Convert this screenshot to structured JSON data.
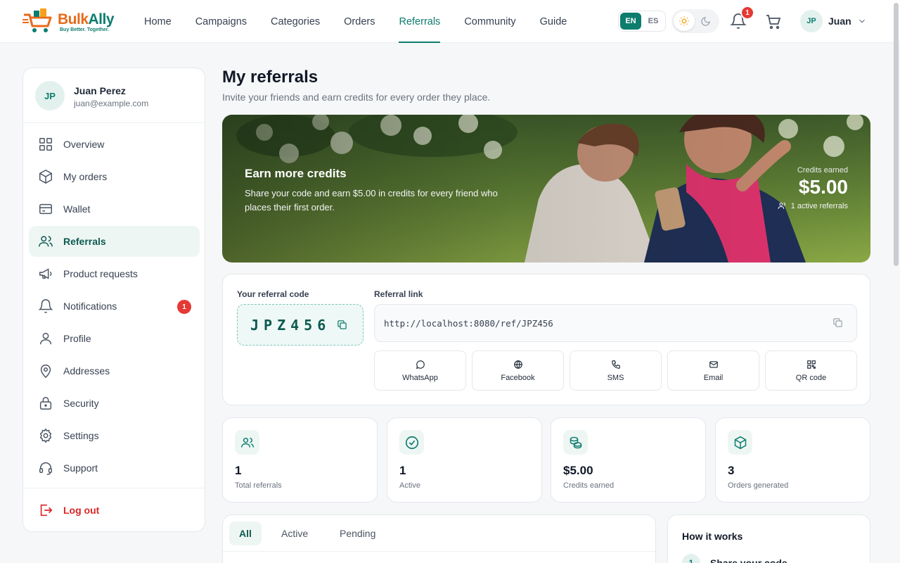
{
  "brand": {
    "name_a": "Bulk",
    "name_b": "Ally",
    "tagline": "Buy Better. Together."
  },
  "nav": [
    {
      "label": "Home"
    },
    {
      "label": "Campaigns"
    },
    {
      "label": "Categories"
    },
    {
      "label": "Orders"
    },
    {
      "label": "Referrals",
      "active": true
    },
    {
      "label": "Community"
    },
    {
      "label": "Guide"
    }
  ],
  "language": {
    "options": [
      "EN",
      "ES"
    ],
    "selected": "EN"
  },
  "theme": {
    "selected": "light"
  },
  "notifications": {
    "count": "1"
  },
  "user": {
    "initials": "JP",
    "short_name": "Juan",
    "full_name": "Juan Perez",
    "email": "juan@example.com"
  },
  "sidebar": {
    "items": [
      {
        "label": "Overview",
        "icon": "grid-icon"
      },
      {
        "label": "My orders",
        "icon": "box-icon"
      },
      {
        "label": "Wallet",
        "icon": "wallet-icon"
      },
      {
        "label": "Referrals",
        "icon": "users-icon",
        "active": true
      },
      {
        "label": "Product requests",
        "icon": "megaphone-icon"
      },
      {
        "label": "Notifications",
        "icon": "bell-icon",
        "badge": "1"
      },
      {
        "label": "Profile",
        "icon": "user-icon"
      },
      {
        "label": "Addresses",
        "icon": "map-pin-icon"
      },
      {
        "label": "Security",
        "icon": "lock-icon"
      },
      {
        "label": "Settings",
        "icon": "gear-icon"
      },
      {
        "label": "Support",
        "icon": "headset-icon"
      }
    ],
    "logout": "Log out"
  },
  "page": {
    "title": "My referrals",
    "subtitle": "Invite your friends and earn credits for every order they place."
  },
  "hero": {
    "title": "Earn more credits",
    "text": "Share your code and earn $5.00 in credits for every friend who places their first order.",
    "credits_label": "Credits earned",
    "credits_value": "$5.00",
    "active_text": "1 active referrals"
  },
  "referral": {
    "code_label": "Your referral code",
    "code": "JPZ456",
    "link_label": "Referral link",
    "link": "http://localhost:8080/ref/JPZ456",
    "share": [
      {
        "label": "WhatsApp",
        "icon": "chat-bubble-icon"
      },
      {
        "label": "Facebook",
        "icon": "globe-icon"
      },
      {
        "label": "SMS",
        "icon": "phone-icon"
      },
      {
        "label": "Email",
        "icon": "mail-icon"
      },
      {
        "label": "QR code",
        "icon": "qr-code-icon"
      }
    ]
  },
  "stats": [
    {
      "value": "1",
      "label": "Total referrals",
      "icon": "users-icon"
    },
    {
      "value": "1",
      "label": "Active",
      "icon": "check-circle-icon"
    },
    {
      "value": "$5.00",
      "label": "Credits earned",
      "icon": "coins-icon"
    },
    {
      "value": "3",
      "label": "Orders generated",
      "icon": "box-icon"
    }
  ],
  "tabs": [
    {
      "label": "All",
      "active": true
    },
    {
      "label": "Active"
    },
    {
      "label": "Pending"
    }
  ],
  "how_it_works": {
    "title": "How it works",
    "steps": [
      {
        "num": "1",
        "label": "Share your code"
      }
    ]
  },
  "colors": {
    "accent": "#0d7d6e",
    "brand_orange": "#e86a1a",
    "danger": "#e53935"
  }
}
